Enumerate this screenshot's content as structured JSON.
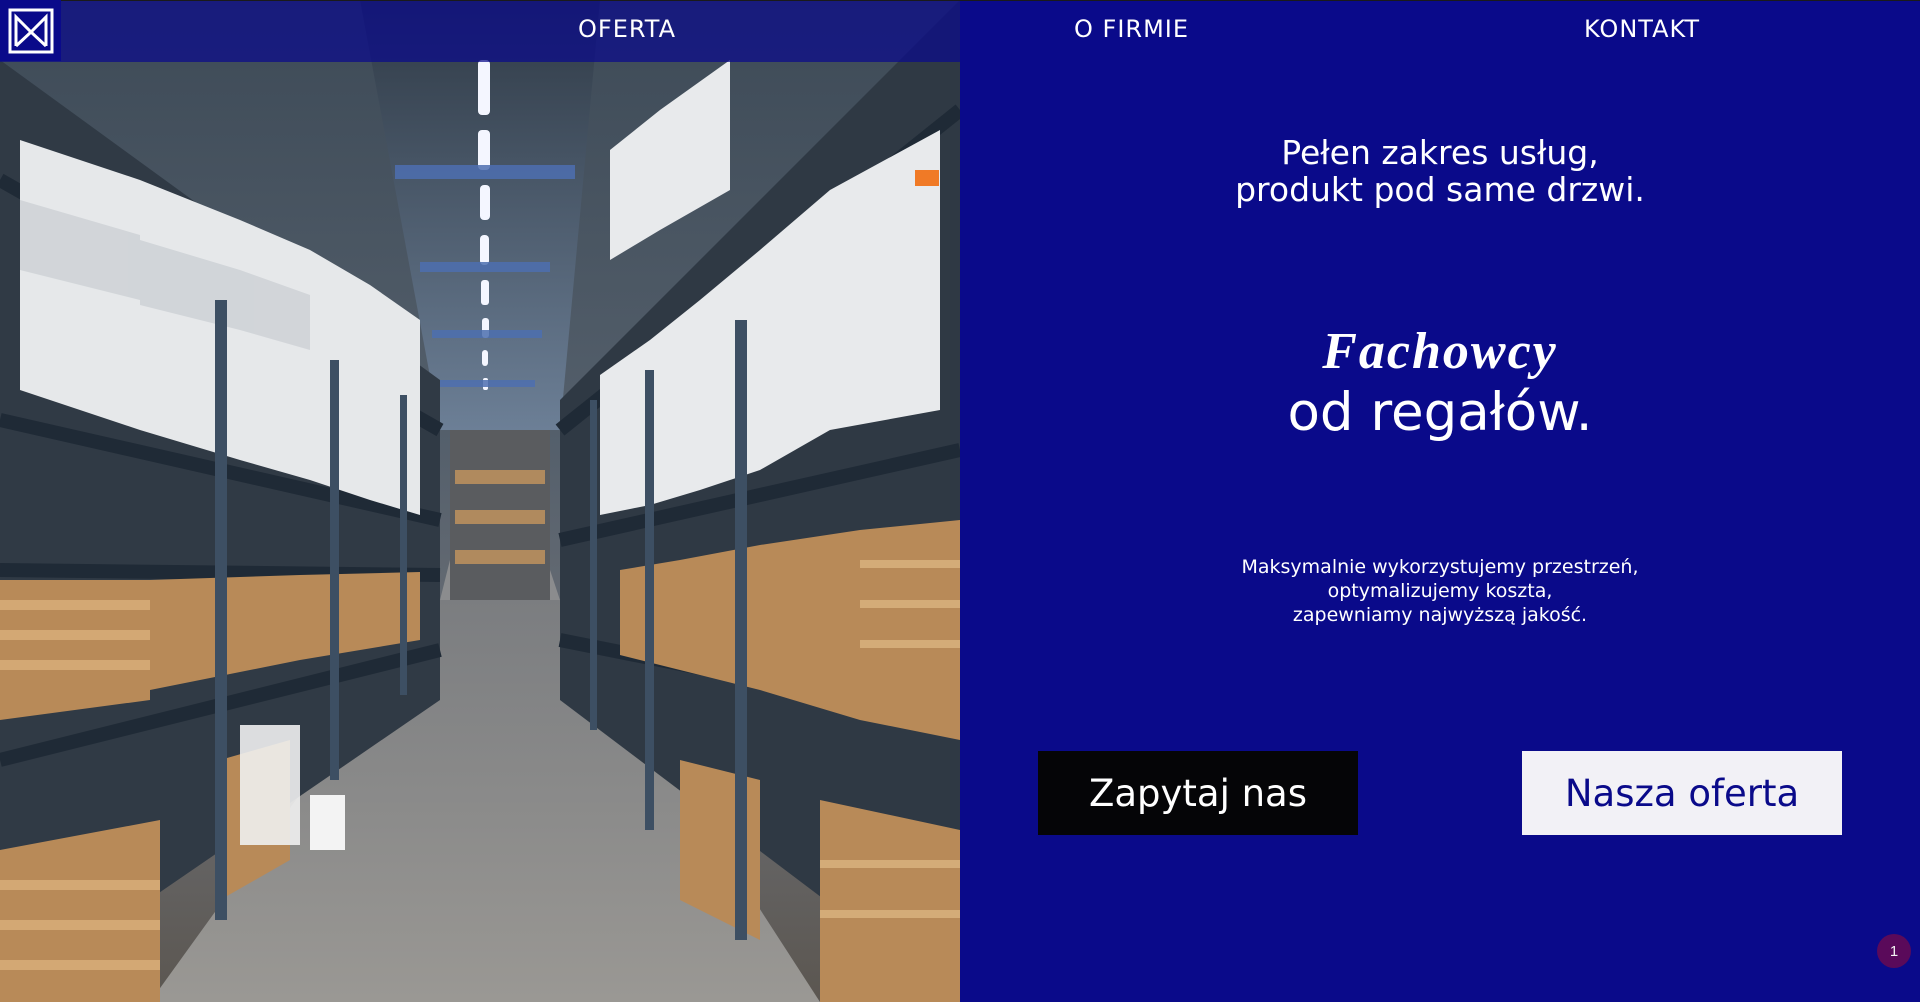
{
  "nav": {
    "items": [
      {
        "label": "OFERTA"
      },
      {
        "label": "O FIRMIE"
      },
      {
        "label": "KONTAKT"
      }
    ]
  },
  "hero": {
    "tagline_line1": "Pełen zakres usług,",
    "tagline_line2": "produkt pod same drzwi.",
    "headline_italic": "Fachowcy",
    "headline_main": "od regałów.",
    "desc_line1": "Maksymalnie wykorzystujemy przestrzeń,",
    "desc_line2": "optymalizujemy koszta,",
    "desc_line3": "zapewniamy najwyższą jakość.",
    "button_ask": "Zapytaj nas",
    "button_offer": "Nasza oferta"
  },
  "badge": {
    "count": "1"
  },
  "icons": {
    "logo": "brand-logo-icon"
  },
  "colors": {
    "brand_blue": "#0a0a8a",
    "button_dark": "#050507",
    "button_light": "#f2f1f6",
    "badge": "#5a0a5a"
  }
}
